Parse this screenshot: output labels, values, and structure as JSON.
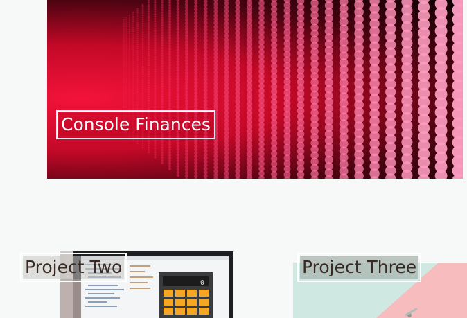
{
  "featured": {
    "title": "Console Finances",
    "image_icon": "led-dot-matrix-image",
    "accent_color": "#e8123c"
  },
  "projects": [
    {
      "title": "Project Two",
      "image_icon": "laptop-calculator-image",
      "accent_color": "#f5a623"
    },
    {
      "title": "Project Three",
      "image_icon": "pastel-desk-image",
      "accent_color": "#f4c6c6"
    }
  ]
}
